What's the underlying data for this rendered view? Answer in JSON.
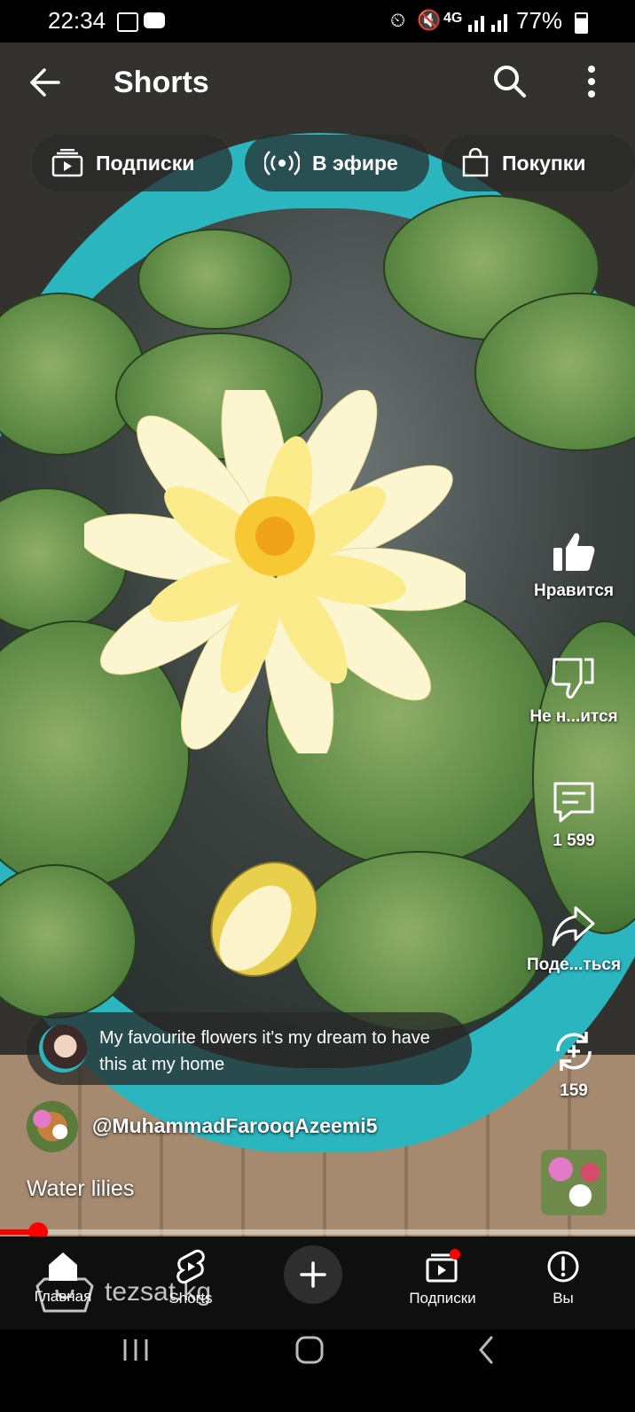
{
  "status_bar": {
    "time": "22:34",
    "network": "4G",
    "battery": "77%",
    "icons": [
      "gallery-icon",
      "youtube-icon",
      "alarm-icon",
      "mute-icon",
      "signal-icon",
      "battery-icon"
    ]
  },
  "header": {
    "title": "Shorts"
  },
  "chips": [
    {
      "label": "Подписки",
      "icon": "subscriptions-icon"
    },
    {
      "label": "В эфире",
      "icon": "live-icon"
    },
    {
      "label": "Покупки",
      "icon": "shopping-bag-icon"
    }
  ],
  "actions": {
    "like_label": "Нравится",
    "dislike_label": "Не н...ится",
    "comments_count": "1 599",
    "share_label": "Поде...ться",
    "remix_count": "159"
  },
  "video": {
    "caption": "My favourite flowers it's my dream to have this at my home",
    "channel": "@MuhammadFarooqAzeemi5",
    "title": "Water lilies",
    "progress_fraction": 0.06
  },
  "nav": {
    "home": "Главная",
    "shorts": "Shorts",
    "subscriptions": "Подписки",
    "you": "Вы"
  },
  "watermark": "tezsat.kg",
  "colors": {
    "accent_red": "#ff0000",
    "tub": "#2ab5bf"
  }
}
